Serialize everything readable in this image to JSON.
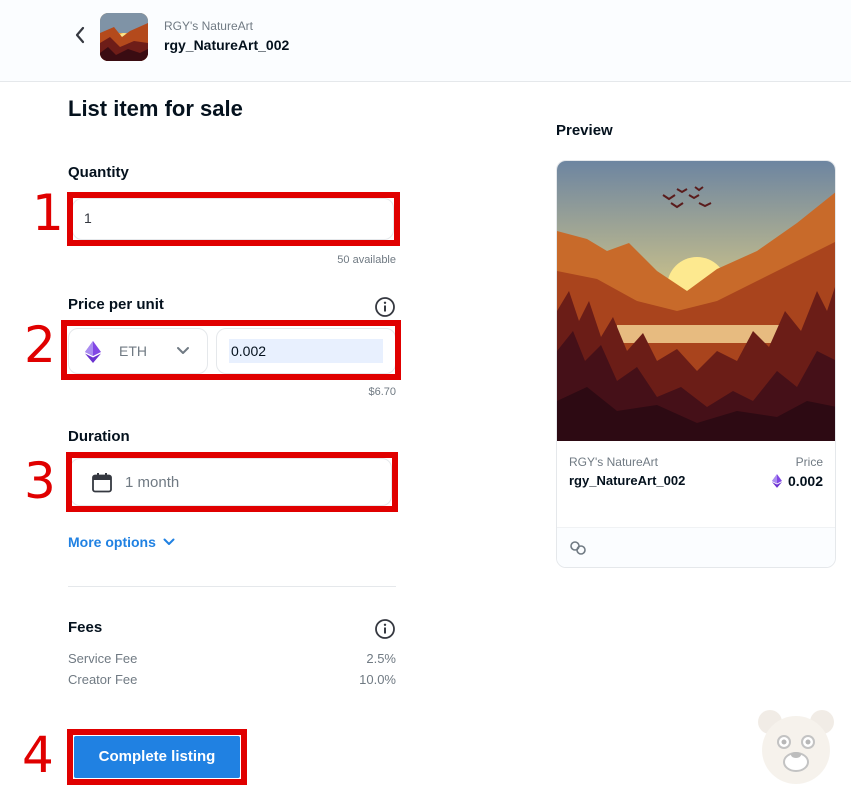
{
  "header": {
    "collection": "RGY's NatureArt",
    "item": "rgy_NatureArt_002"
  },
  "form": {
    "title": "List item for sale",
    "quantity": {
      "label": "Quantity",
      "value": "1",
      "available": "50 available"
    },
    "price": {
      "label": "Price per unit",
      "currency": "ETH",
      "value": "0.002",
      "usd": "$6.70"
    },
    "duration": {
      "label": "Duration",
      "value": "1 month"
    },
    "more_options": "More options",
    "fees": {
      "label": "Fees",
      "items": [
        {
          "name": "Service Fee",
          "value": "2.5%"
        },
        {
          "name": "Creator Fee",
          "value": "10.0%"
        }
      ]
    },
    "submit_label": "Complete listing"
  },
  "preview": {
    "title": "Preview",
    "collection": "RGY's NatureArt",
    "item": "rgy_NatureArt_002",
    "price_label": "Price",
    "price": "0.002"
  },
  "annotations": [
    "1",
    "2",
    "3",
    "4"
  ],
  "colors": {
    "accent": "#2081e2",
    "annotation": "#e00000",
    "eth": "#8247e5"
  }
}
